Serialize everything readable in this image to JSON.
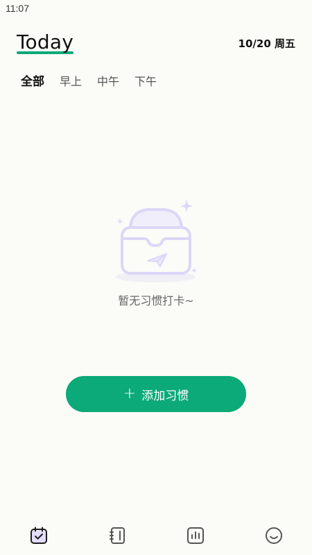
{
  "status_bar": {
    "time": "11:07"
  },
  "header": {
    "title": "Today",
    "date": "10/20 周五"
  },
  "tabs": [
    {
      "label": "全部",
      "active": true
    },
    {
      "label": "早上",
      "active": false
    },
    {
      "label": "中午",
      "active": false
    },
    {
      "label": "下午",
      "active": false
    }
  ],
  "empty_state": {
    "message": "暂无习惯打卡~",
    "icon": "empty-inbox-icon"
  },
  "actions": {
    "add_habit_label": "添加习惯",
    "add_icon": "plus-icon"
  },
  "bottom_nav": {
    "items": [
      {
        "icon": "calendar-check-icon",
        "active": true
      },
      {
        "icon": "notebook-icon",
        "active": false
      },
      {
        "icon": "stats-icon",
        "active": false
      },
      {
        "icon": "smiley-icon",
        "active": false
      }
    ]
  },
  "colors": {
    "background": "#FBFBF7",
    "accent": "#0BAA78",
    "illustration": "#DCD6F7"
  }
}
